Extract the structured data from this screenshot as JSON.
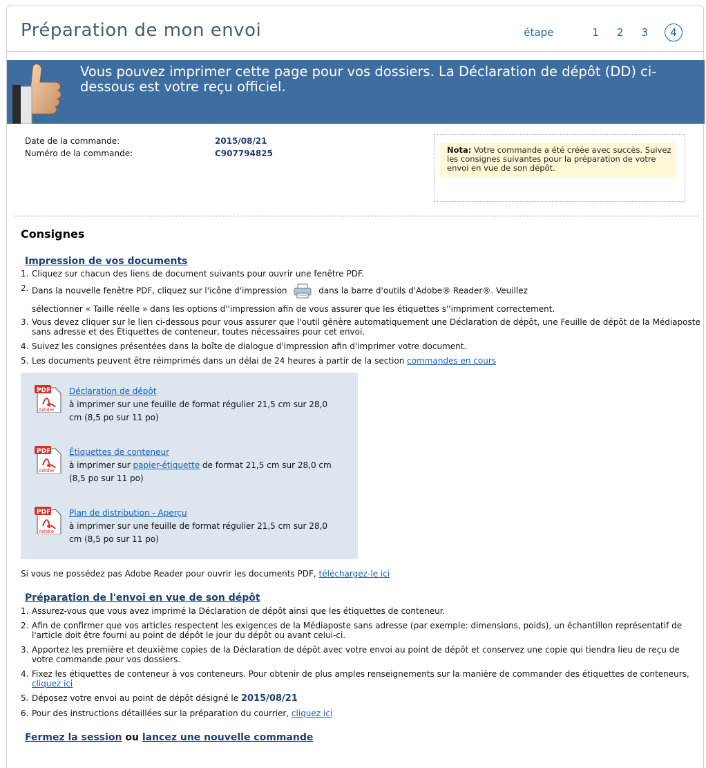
{
  "header": {
    "title": "Préparation de mon envoi",
    "step_label": "étape",
    "steps": [
      "1",
      "2",
      "3",
      "4"
    ],
    "current_step": "4"
  },
  "banner": {
    "message": "Vous pouvez imprimer cette page pour vos dossiers. La Déclaration de dépôt (DD) ci-dessous est votre reçu officiel.",
    "icon": "thumbs-up-icon",
    "background_color": "#3d6e9f"
  },
  "order": {
    "date_label": "Date de la commande:",
    "date_value": "2015/08/21",
    "number_label": "Numéro de la commande:",
    "number_value": "C907794825"
  },
  "nota": {
    "label": "Nota:",
    "text": "Votre commande a été créée avec succès. Suivez les consignes suivantes pour la préparation de votre envoi en vue de son dépôt."
  },
  "consignes": {
    "title": "Consignes",
    "printing": {
      "heading": "Impression de vos documents",
      "items": [
        {
          "num": "1.",
          "text": "Cliquez sur chacun des liens de document suivants pour ouvrir une fenêtre PDF."
        },
        {
          "num": "2.",
          "text_before": "Dans la nouvelle fenêtre PDF, cliquez sur l'icône d'impression",
          "text_after": "dans la barre d'outils d'Adobe® Reader®. Veuillez",
          "text_line2": "sélectionner « Taille réelle » dans les options d''impression afin de vous assurer que les étiquettes s''impriment correctement."
        },
        {
          "num": "3.",
          "text": "Vous devez cliquer sur le lien ci-dessous pour vous assurer que l'outil génère automatiquement une Déclaration de dépôt, une Feuille de dépôt de la Médiaposte sans adresse et des Étiquettes de conteneur, toutes nécessaires pour cet envoi."
        },
        {
          "num": "4.",
          "text": "Suivez les consignes présentées dans la boîte de dialogue d'impression afin d'imprimer votre document."
        },
        {
          "num": "5.",
          "text": "Les documents peuvent être réimprimés dans un délai de 24 heures à partir de la section",
          "link": "commandes en cours"
        }
      ],
      "documents": [
        {
          "link": "Déclaration de dépôt",
          "desc": "à imprimer sur une feuille de format régulier 21,5 cm sur 28,0 cm (8,5 po sur 11 po)"
        },
        {
          "link": "Étiquettes de conteneur",
          "desc_before": "à imprimer sur",
          "desc_link": "papier-étiquette",
          "desc_after": "de format 21,5 cm sur 28,0 cm (8,5 po sur 11 po)"
        },
        {
          "link": "Plan de distribution - Aperçu",
          "desc": "à imprimer sur une feuille de format régulier 21,5 cm sur 28,0 cm (8,5 po sur 11 po)"
        }
      ],
      "adobe_text": "Si vous ne possédez pas Adobe Reader pour ouvrir les documents PDF,",
      "adobe_link": "téléchargez-le ici"
    },
    "preparation": {
      "heading": "Préparation de l'envoi en vue de son dépôt",
      "items": [
        {
          "num": "1.",
          "text": "Assurez-vous que vous avez imprimé la Déclaration de dépôt ainsi que les étiquettes de conteneur."
        },
        {
          "num": "2.",
          "text": "Afin de confirmer que vos articles respectent les exigences de la Médiaposte sans adresse (par exemple: dimensions, poids), un échantillon représentatif de l'article doit être fourni au point de dépôt le jour du dépôt ou avant celui-ci."
        },
        {
          "num": "3.",
          "text": "Apportez les première et deuxième copies de la Déclaration de dépôt avec votre envoi au point de dépôt et conservez une copie qui tiendra lieu de reçu de votre commande pour vos dossiers."
        },
        {
          "num": "4.",
          "text": "Fixez les étiquettes de conteneur à vos conteneurs. Pour obtenir de plus amples renseignements sur la manière de commander des étiquettes de conteneurs,",
          "link": "cliquez ici"
        },
        {
          "num": "5.",
          "text": "Déposez votre envoi au point de dépôt désigné le",
          "date": "2015/08/21"
        },
        {
          "num": "6.",
          "text": "Pour des instructions détaillées sur la préparation du courrier,",
          "link": "cliquez ici"
        }
      ]
    }
  },
  "footer": {
    "logout_link": "Fermez la session",
    "or": "ou",
    "new_order_link": "lancez une nouvelle commande"
  }
}
